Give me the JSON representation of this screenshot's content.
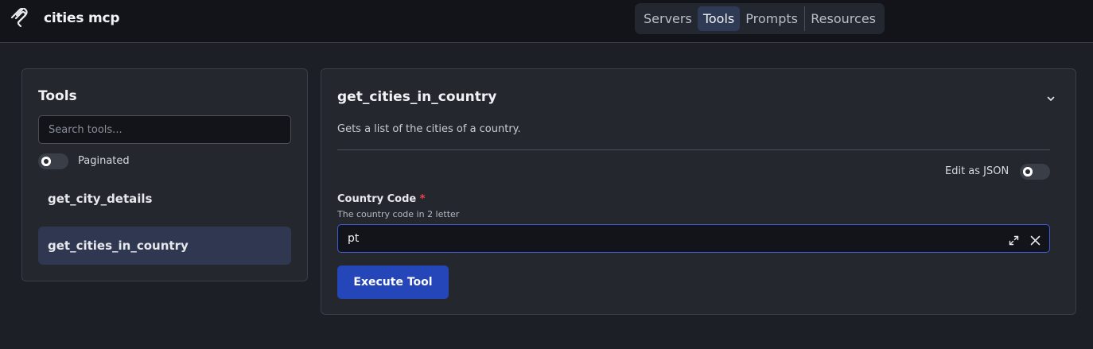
{
  "app": {
    "title": "cities mcp",
    "logo_icon": "mcp-logo-icon"
  },
  "nav": {
    "items": [
      {
        "label": "Servers",
        "active": false
      },
      {
        "label": "Tools",
        "active": true
      },
      {
        "label": "Prompts",
        "active": false
      },
      {
        "label": "Resources",
        "active": false
      }
    ]
  },
  "sidebar": {
    "title": "Tools",
    "search_placeholder": "Search tools...",
    "paginated_label": "Paginated",
    "paginated_on": false,
    "tools": [
      {
        "name": "get_city_details",
        "selected": false
      },
      {
        "name": "get_cities_in_country",
        "selected": true
      }
    ]
  },
  "tool": {
    "name": "get_cities_in_country",
    "description": "Gets a list of the cities of a country.",
    "edit_as_json_label": "Edit as JSON",
    "edit_as_json_on": false,
    "fields": [
      {
        "label": "Country Code",
        "required_marker": "*",
        "help": "The country code in 2 letter",
        "value": "pt"
      }
    ],
    "execute_label": "Execute Tool"
  },
  "colors": {
    "accent": "#2546b8",
    "input_focus_border": "#3b5bdb",
    "required": "#ef4444",
    "background": "#1c1f26"
  }
}
